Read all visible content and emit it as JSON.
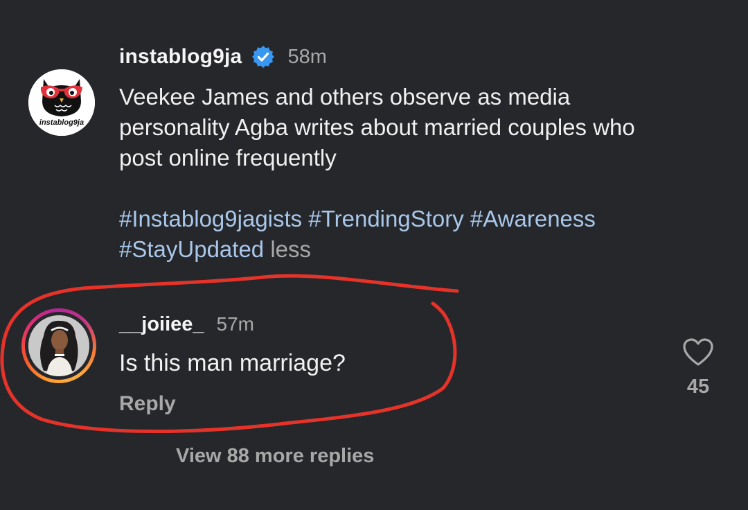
{
  "post": {
    "username": "instablog9ja",
    "time": "58m",
    "caption_lines": [
      "Veekee James and others observe as media",
      "personality Agba writes about married couples who",
      "post online frequently"
    ],
    "hashtags_line1": "#Instablog9jagists #TrendingStory #Awareness",
    "hashtags_line2": "#StayUpdated",
    "less_label": "less",
    "avatar_logo_text": "instablog9ja",
    "icons": {
      "avatar": "owl-logo-icon",
      "verified": "verified-badge-icon"
    },
    "colors": {
      "hashtag": "#a9c7ea",
      "verified": "#3897f0"
    }
  },
  "comment": {
    "username": "__joiiee_",
    "time": "57m",
    "text": "Is this man marriage?",
    "reply_label": "Reply",
    "like_count": "45",
    "icons": {
      "like": "heart-outline-icon",
      "avatar": "profile-photo-icon"
    }
  },
  "view_replies_label": "View 88 more replies",
  "annotation": {
    "color": "#e6332a",
    "shape": "hand-drawn-circle"
  }
}
